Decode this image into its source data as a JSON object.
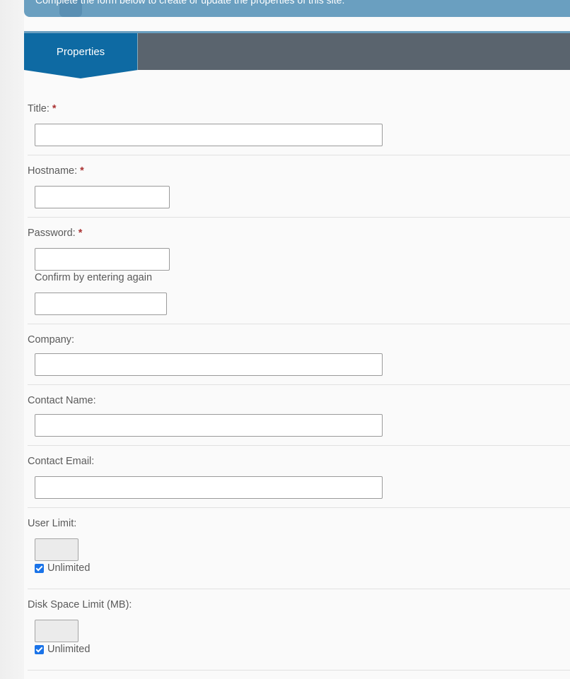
{
  "banner": {
    "text": "Complete the form below to create or update the properties of this site."
  },
  "tabs": [
    {
      "label": "Properties",
      "active": true
    }
  ],
  "form": {
    "title": {
      "label": "Title:",
      "required": "*",
      "value": ""
    },
    "hostname": {
      "label": "Hostname:",
      "required": "*",
      "value": ""
    },
    "password": {
      "label": "Password:",
      "required": "*",
      "value": "",
      "confirm_hint": "Confirm by entering again",
      "confirm_value": ""
    },
    "company": {
      "label": "Company:",
      "value": ""
    },
    "contact_name": {
      "label": "Contact Name:",
      "value": ""
    },
    "contact_email": {
      "label": "Contact Email:",
      "value": ""
    },
    "user_limit": {
      "label": "User Limit:",
      "value": "",
      "unlimited_label": "Unlimited",
      "unlimited_checked": true
    },
    "disk_space_limit": {
      "label": "Disk Space Limit (MB):",
      "value": "",
      "unlimited_label": "Unlimited",
      "unlimited_checked": true
    }
  },
  "colors": {
    "tab_active": "#0e6aa3",
    "tab_bar": "#5a646e",
    "banner": "#6a9fc0",
    "required": "#aa3333",
    "checkbox": "#1a73e8"
  }
}
